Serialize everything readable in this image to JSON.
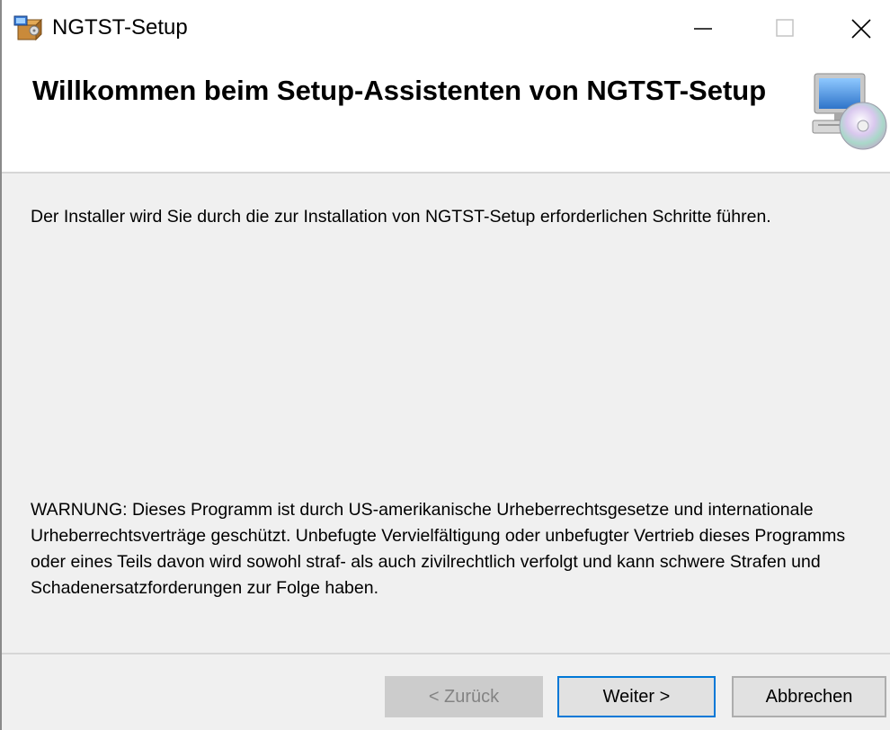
{
  "window": {
    "title": "NGTST-Setup",
    "minimize_icon": "minimize-icon",
    "maximize_icon": "maximize-icon",
    "close_icon": "close-icon",
    "app_icon": "installer-package-icon"
  },
  "header": {
    "title": "Willkommen beim Setup-Assistenten von NGTST-Setup",
    "graphic_icon": "computer-cd-icon"
  },
  "body": {
    "intro": "Der Installer wird Sie durch die zur Installation von NGTST-Setup erforderlichen Schritte führen.",
    "warning": "WARNUNG: Dieses Programm ist durch US-amerikanische Urheberrechtsgesetze und internationale Urheberrechtsverträge geschützt. Unbefugte Vervielfältigung oder unbefugter Vertrieb dieses Programms oder eines Teils davon wird sowohl straf- als auch zivilrechtlich verfolgt und kann schwere Strafen und Schadenersatzforderungen zur Folge haben."
  },
  "footer": {
    "back_label": "< Zurück",
    "next_label": "Weiter >",
    "cancel_label": "Abbrechen"
  },
  "colors": {
    "window_bg": "#f0f0f0",
    "header_bg": "#ffffff",
    "focus_border": "#0078d7",
    "disabled_text": "#838383"
  }
}
